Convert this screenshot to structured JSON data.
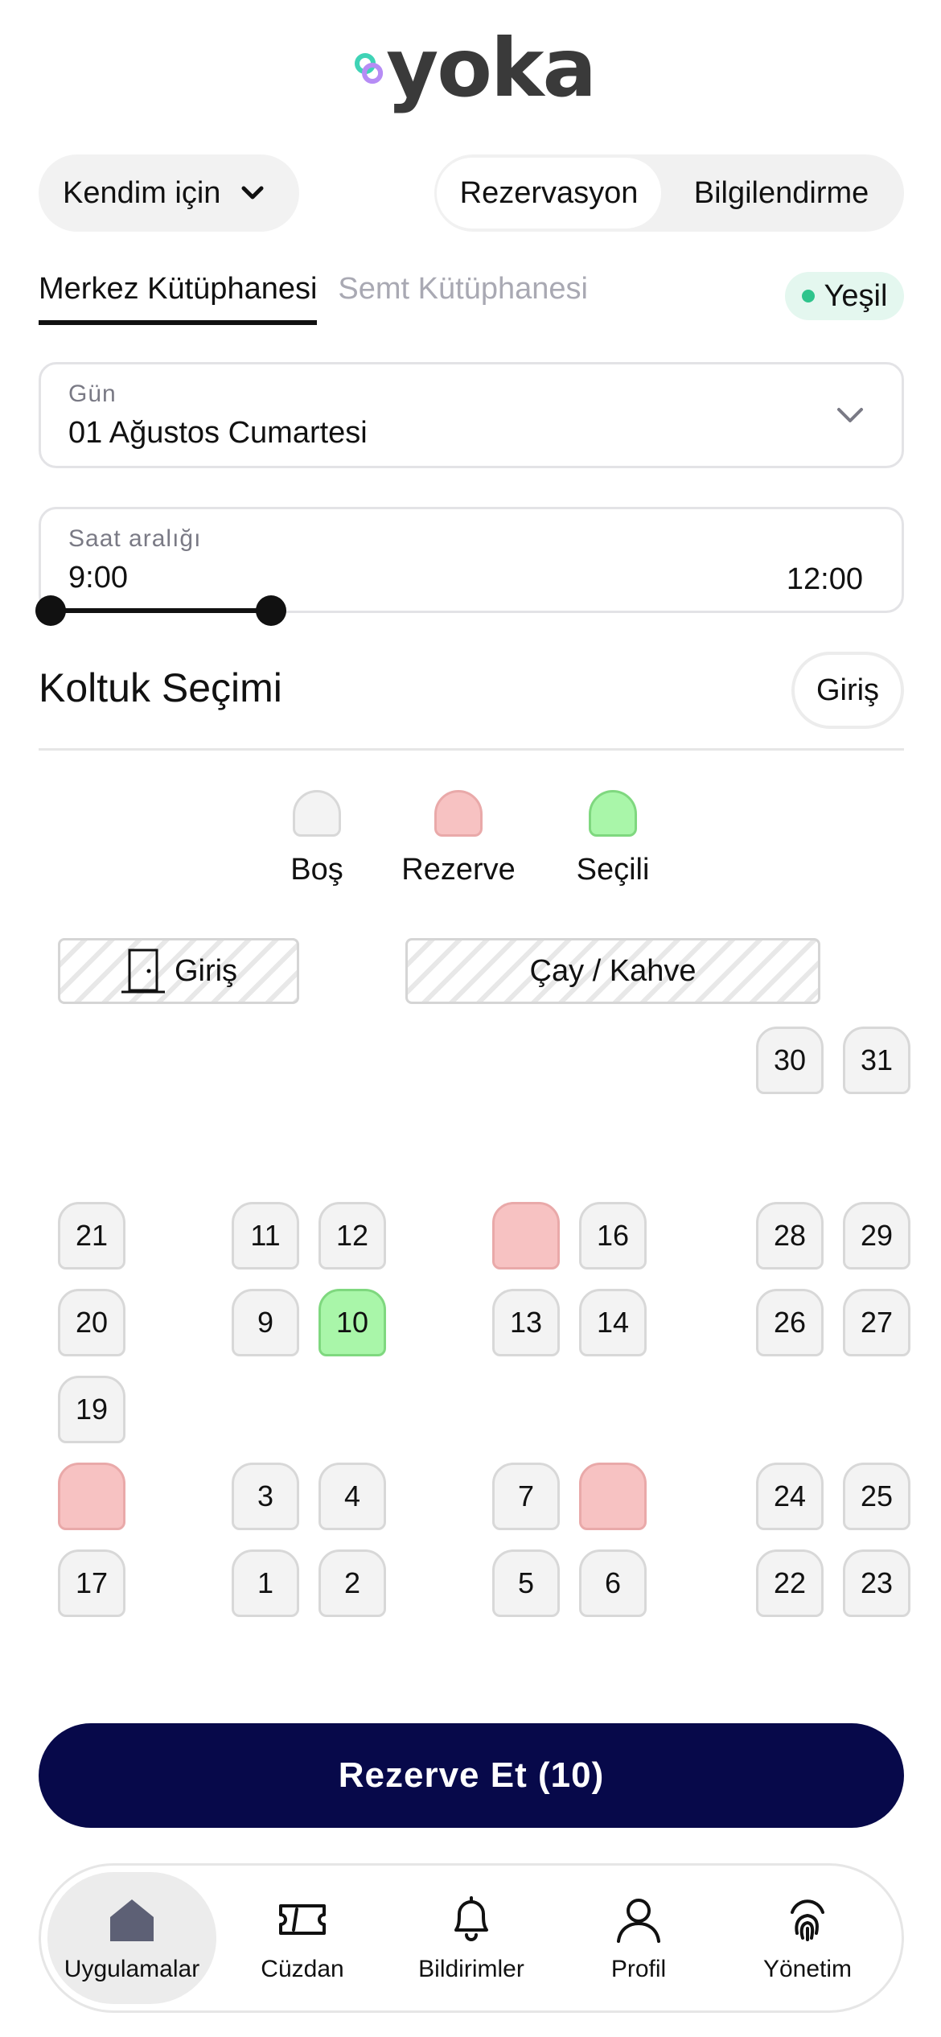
{
  "brand": {
    "name": "yoka"
  },
  "header": {
    "for_dropdown": "Kendim için",
    "segments": [
      "Rezervasyon",
      "Bilgilendirme"
    ]
  },
  "library_tabs": [
    "Merkez Kütüphanesi",
    "Semt Kütüphanesi"
  ],
  "status_badge": "Yeşil",
  "day_field": {
    "label": "Gün",
    "value": "01 Ağustos Cumartesi"
  },
  "time_field": {
    "label": "Saat aralığı",
    "start": "9:00",
    "end": "12:00"
  },
  "seat_section": {
    "title": "Koltuk Seçimi",
    "entrance_button": "Giriş"
  },
  "legend": [
    {
      "label": "Boş",
      "color": "#f3f3f3"
    },
    {
      "label": "Rezerve",
      "color": "#f7c2c2"
    },
    {
      "label": "Seçili",
      "color": "#a9f6a9"
    }
  ],
  "zones": {
    "entrance": "Giriş",
    "tea_coffee": "Çay / Kahve"
  },
  "seats": [
    {
      "id": "seat-30",
      "label": "30",
      "state": "free"
    },
    {
      "id": "seat-31",
      "label": "31",
      "state": "free"
    },
    {
      "id": "seat-21",
      "label": "21",
      "state": "free"
    },
    {
      "id": "seat-11",
      "label": "11",
      "state": "free"
    },
    {
      "id": "seat-12",
      "label": "12",
      "state": "free"
    },
    {
      "id": "seat-15",
      "label": "",
      "state": "reserved"
    },
    {
      "id": "seat-16",
      "label": "16",
      "state": "free"
    },
    {
      "id": "seat-28",
      "label": "28",
      "state": "free"
    },
    {
      "id": "seat-29",
      "label": "29",
      "state": "free"
    },
    {
      "id": "seat-20",
      "label": "20",
      "state": "free"
    },
    {
      "id": "seat-9",
      "label": "9",
      "state": "free"
    },
    {
      "id": "seat-10",
      "label": "10",
      "state": "selected"
    },
    {
      "id": "seat-13",
      "label": "13",
      "state": "free"
    },
    {
      "id": "seat-14",
      "label": "14",
      "state": "free"
    },
    {
      "id": "seat-26",
      "label": "26",
      "state": "free"
    },
    {
      "id": "seat-27",
      "label": "27",
      "state": "free"
    },
    {
      "id": "seat-19",
      "label": "19",
      "state": "free"
    },
    {
      "id": "seat-18",
      "label": "",
      "state": "reserved"
    },
    {
      "id": "seat-3",
      "label": "3",
      "state": "free"
    },
    {
      "id": "seat-4",
      "label": "4",
      "state": "free"
    },
    {
      "id": "seat-7",
      "label": "7",
      "state": "free"
    },
    {
      "id": "seat-8",
      "label": "",
      "state": "reserved"
    },
    {
      "id": "seat-24",
      "label": "24",
      "state": "free"
    },
    {
      "id": "seat-25",
      "label": "25",
      "state": "free"
    },
    {
      "id": "seat-17",
      "label": "17",
      "state": "free"
    },
    {
      "id": "seat-1",
      "label": "1",
      "state": "free"
    },
    {
      "id": "seat-2",
      "label": "2",
      "state": "free"
    },
    {
      "id": "seat-5",
      "label": "5",
      "state": "free"
    },
    {
      "id": "seat-6",
      "label": "6",
      "state": "free"
    },
    {
      "id": "seat-22",
      "label": "22",
      "state": "free"
    },
    {
      "id": "seat-23",
      "label": "23",
      "state": "free"
    }
  ],
  "cta": {
    "label": "Rezerve Et (10)"
  },
  "nav": [
    {
      "label": "Uygulamalar",
      "icon": "home-icon",
      "active": true
    },
    {
      "label": "Cüzdan",
      "icon": "ticket-icon"
    },
    {
      "label": "Bildirimler",
      "icon": "bell-icon"
    },
    {
      "label": "Profil",
      "icon": "user-icon"
    },
    {
      "label": "Yönetim",
      "icon": "fingerprint-icon"
    }
  ],
  "colors": {
    "primary": "#07094a",
    "reserved": "#f7c2c2",
    "selected": "#a9f6a9",
    "status": "#2fc48c"
  }
}
